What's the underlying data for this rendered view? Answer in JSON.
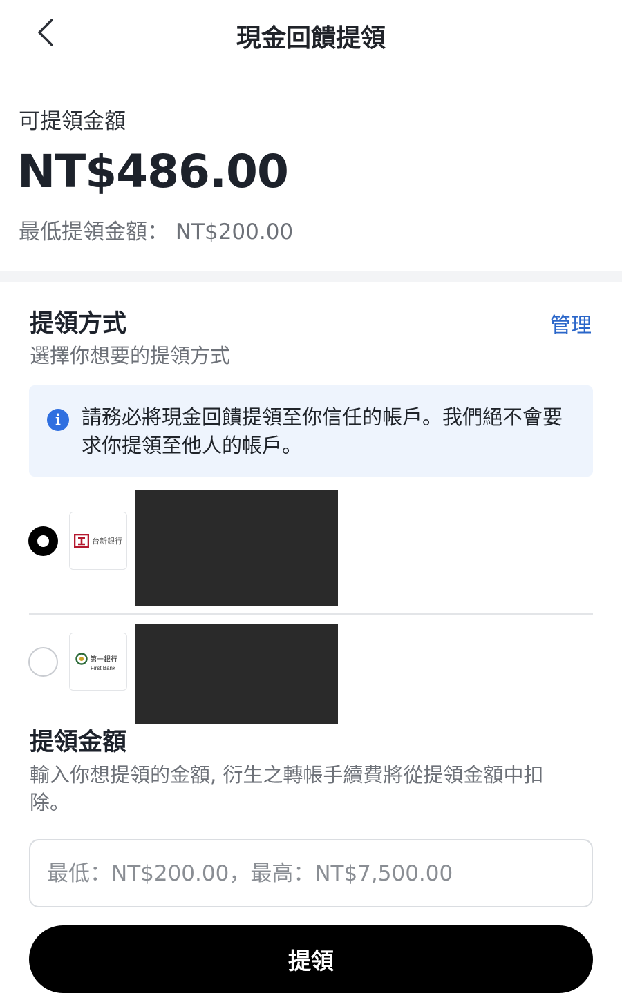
{
  "header": {
    "title": "現金回饋提領",
    "back_icon": "chevron-left-icon"
  },
  "balance": {
    "label": "可提領金額",
    "amount": "NT$486.00",
    "min_text": "最低提領金額： NT$200.00"
  },
  "method": {
    "title": "提領方式",
    "subtitle": "選擇你想要的提領方式",
    "manage_label": "管理",
    "notice": "請務必將現金回饋提領至你信任的帳戶。我們絕不會要求你提領至他人的帳戶。",
    "accounts": [
      {
        "bank_name": "台新銀行",
        "selected": true
      },
      {
        "bank_name": "第一銀行",
        "bank_name_en": "First Bank",
        "selected": false
      }
    ]
  },
  "amount": {
    "title": "提領金額",
    "subtitle": "輸入你想提領的金額, 衍生之轉帳手續費將從提領金額中扣除。",
    "placeholder": "最低：NT$200.00，最高：NT$7,500.00"
  },
  "submit_label": "提領",
  "colors": {
    "accent_link": "#2a66c9",
    "info_icon": "#2f6fe0",
    "notice_bg": "#eef4fd",
    "primary_button": "#000000",
    "taishin_red": "#b5182e",
    "firstbank_green": "#2d6b3a"
  }
}
